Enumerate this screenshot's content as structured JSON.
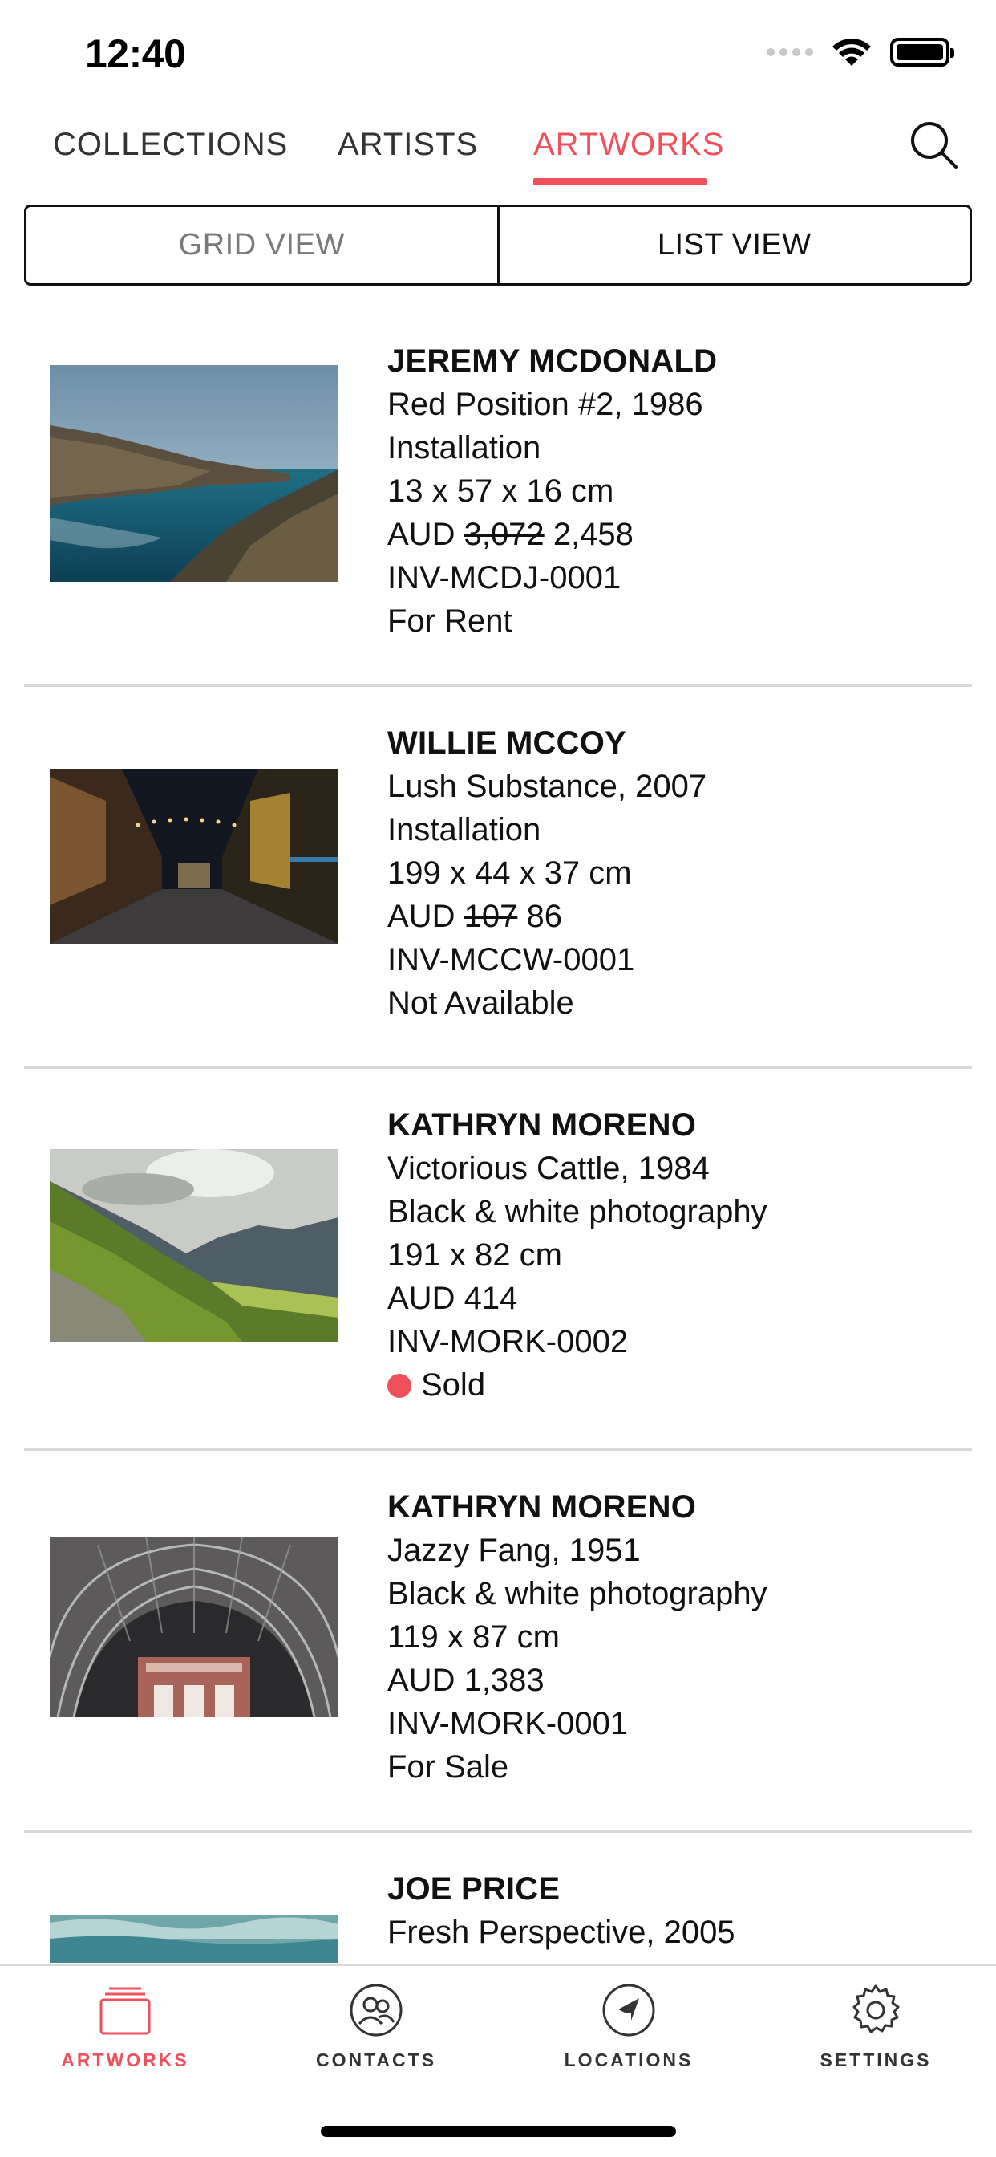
{
  "status_bar": {
    "time": "12:40"
  },
  "top_tabs": {
    "collections": "COLLECTIONS",
    "artists": "ARTISTS",
    "artworks": "ARTWORKS",
    "active": "ARTWORKS"
  },
  "view_toggle": {
    "grid": "GRID VIEW",
    "list": "LIST VIEW",
    "selected": "LIST VIEW"
  },
  "artworks": [
    {
      "artist": "JEREMY MCDONALD",
      "title_year": "Red Position #2, 1986",
      "medium": "Installation",
      "dimensions": "13 x 57 x 16 cm",
      "currency": "AUD",
      "original_price": "3,072",
      "price": "2,458",
      "inventory": "INV-MCDJ-0001",
      "status": "For Rent",
      "thumbnail": "coastline-image"
    },
    {
      "artist": "WILLIE MCCOY",
      "title_year": "Lush Substance, 2007",
      "medium": "Installation",
      "dimensions": "199 x 44 x 37 cm",
      "currency": "AUD",
      "original_price": "107",
      "price": "86",
      "inventory": "INV-MCCW-0001",
      "status": "Not Available",
      "thumbnail": "night-street-image"
    },
    {
      "artist": "KATHRYN MORENO",
      "title_year": "Victorious Cattle, 1984",
      "medium": "Black & white photography",
      "dimensions": "191 x 82 cm",
      "price_line": "AUD 414",
      "inventory": "INV-MORK-0002",
      "status": "Sold",
      "status_color": "#f0505b",
      "thumbnail": "mountain-valley-image"
    },
    {
      "artist": "KATHRYN MORENO",
      "title_year": "Jazzy Fang, 1951",
      "medium": "Black & white photography",
      "dimensions": "119 x 87 cm",
      "price_line": "AUD 1,383",
      "inventory": "INV-MORK-0001",
      "status": "For Sale",
      "thumbnail": "arched-hall-image"
    },
    {
      "artist": "JOE PRICE",
      "title_year": "Fresh Perspective, 2005",
      "thumbnail": "sea-image"
    }
  ],
  "tab_bar": {
    "artworks": "ARTWORKS",
    "contacts": "CONTACTS",
    "locations": "LOCATIONS",
    "settings": "SETTINGS",
    "active": "ARTWORKS"
  },
  "colors": {
    "accent": "#f0505b",
    "divider": "#d8d8d8",
    "text": "#111111",
    "muted": "#7a7a7a"
  }
}
